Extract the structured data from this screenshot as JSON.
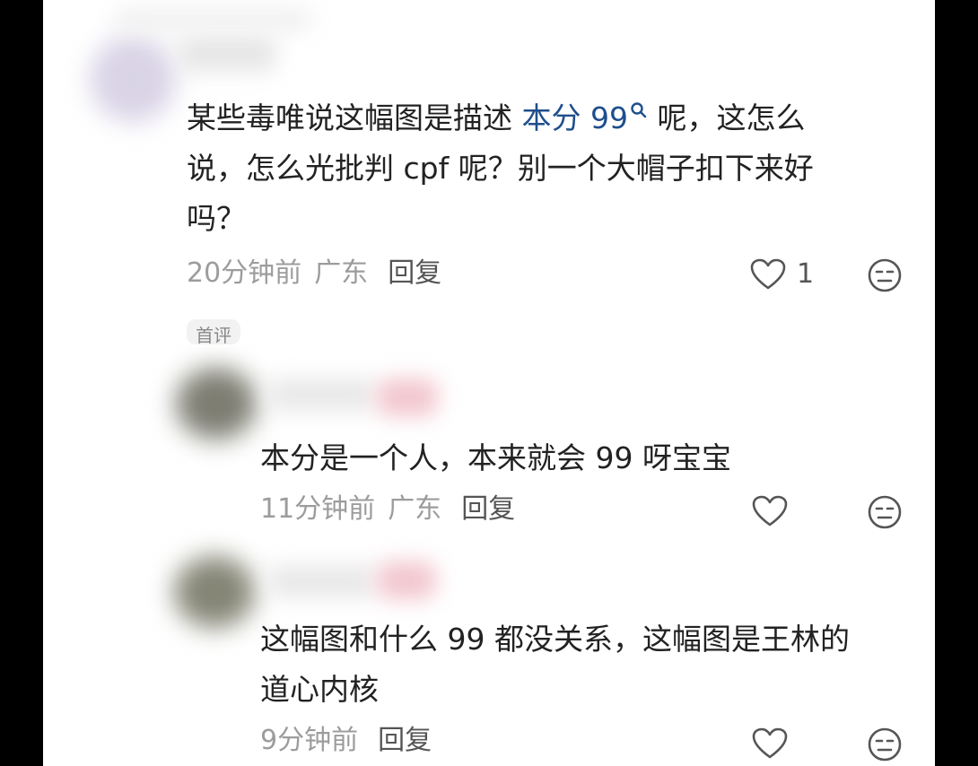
{
  "comments": [
    {
      "text_line1_prefix": "某些毒唯说这幅图是描述",
      "text_line1_link": "本分 99",
      "text_line1_suffix": "呢，这怎么",
      "text_line2": "说，怎么光批判 cpf 呢？别一个大帽子扣下来好",
      "text_line3": "吗？",
      "time": "20分钟前",
      "location": "广东",
      "reply_label": "回复",
      "like_count": "1"
    }
  ],
  "tag_label": "首评",
  "replies": [
    {
      "text": "本分是一个人，本来就会 99 呀宝宝",
      "time": "11分钟前",
      "location": "广东",
      "reply_label": "回复"
    },
    {
      "text_line1": "这幅图和什么 99 都没关系，这幅图是王林的",
      "text_line2": "道心内核",
      "time": "9分钟前",
      "reply_label": "回复"
    }
  ],
  "icons": [
    "search-icon",
    "heart-icon",
    "dislike-face-icon"
  ],
  "colors": {
    "link": "#1f4e8c",
    "meta": "#9c9c9c",
    "text": "#222222"
  }
}
